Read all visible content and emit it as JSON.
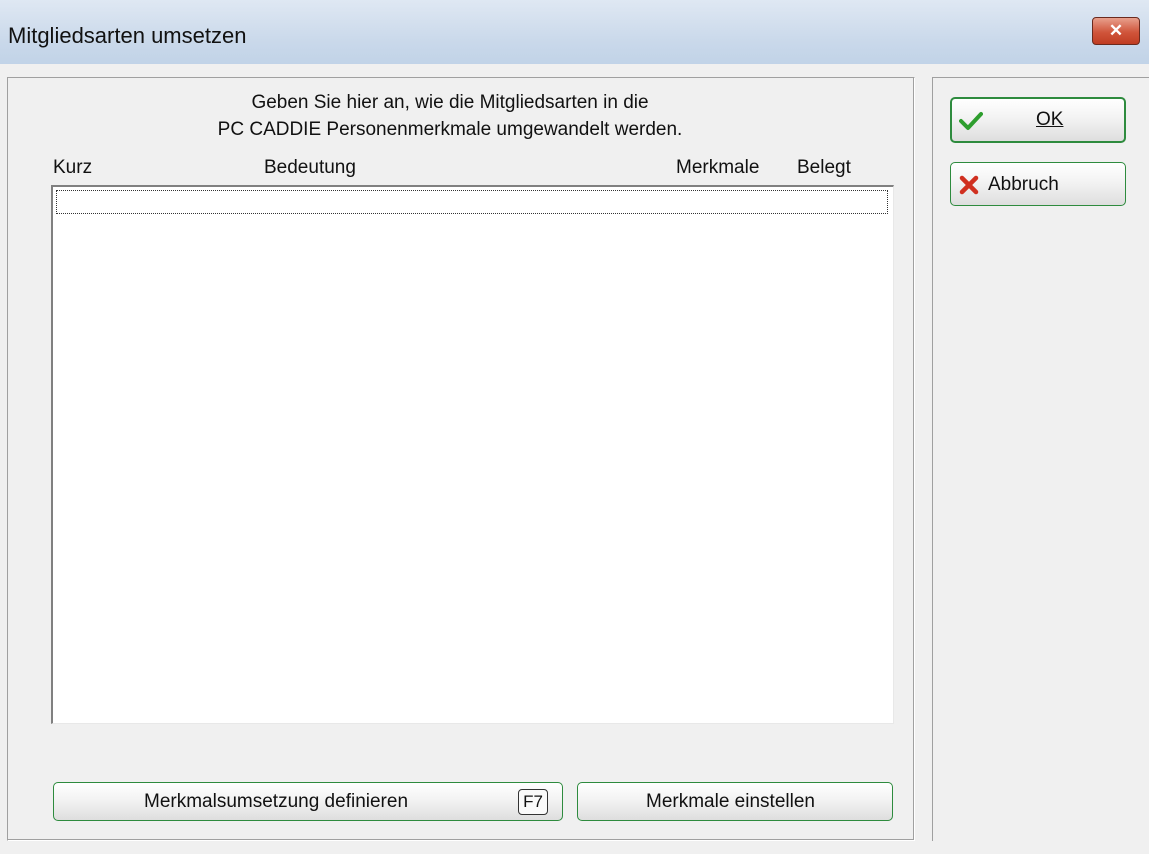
{
  "window": {
    "title": "Mitgliedsarten umsetzen",
    "close_glyph": "✕"
  },
  "instructions": {
    "line1": "Geben Sie hier an, wie die Mitgliedsarten in die",
    "line2": "PC CADDIE Personenmerkmale umgewandelt werden."
  },
  "list": {
    "columns": [
      "Kurz",
      "Bedeutung",
      "Merkmale",
      "Belegt"
    ],
    "rows": []
  },
  "buttons": {
    "ok": {
      "label": "OK",
      "icon": "check-icon",
      "color": "#2e9e2e"
    },
    "cancel": {
      "label": "Abbruch",
      "icon": "cross-icon",
      "color": "#d03020"
    },
    "define": {
      "label": "Merkmalsumsetzung definieren",
      "shortcut": "F7"
    },
    "set": {
      "label": "Merkmale einstellen"
    }
  },
  "colors": {
    "button_border": "#2e8b3e",
    "titlebar": "#c9d8ea"
  }
}
